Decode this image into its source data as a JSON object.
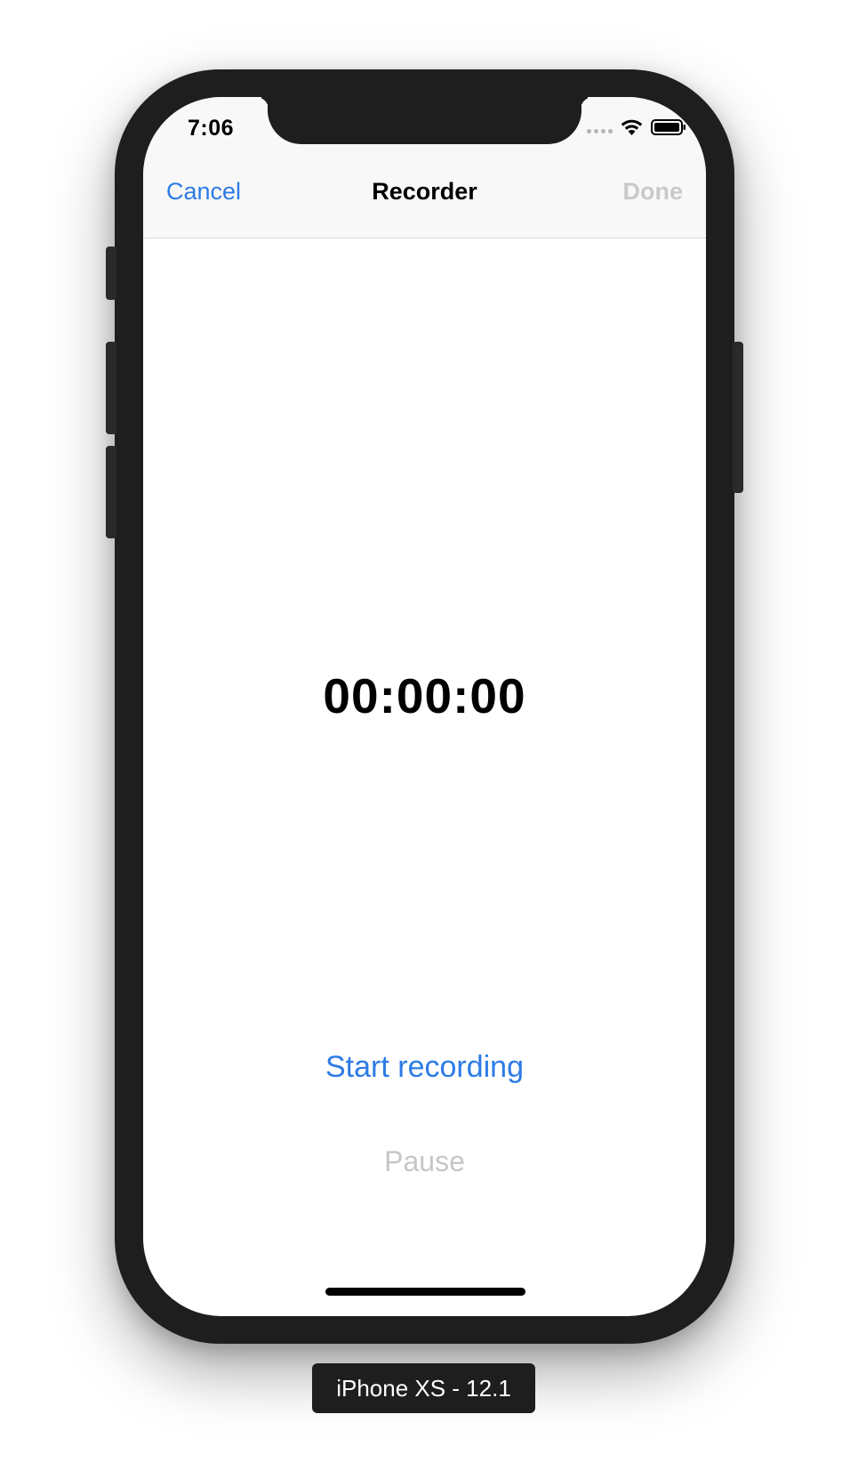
{
  "status_bar": {
    "time": "7:06",
    "wifi_icon": "wifi-icon",
    "battery_icon": "battery-icon"
  },
  "nav_bar": {
    "cancel_label": "Cancel",
    "title": "Recorder",
    "done_label": "Done"
  },
  "main": {
    "timer": "00:00:00",
    "start_label": "Start recording",
    "pause_label": "Pause"
  },
  "simulator": {
    "device_label": "iPhone XS - 12.1"
  },
  "colors": {
    "accent": "#2d7be5",
    "disabled": "#c9c9c9",
    "device_frame": "#1e1e1e"
  }
}
